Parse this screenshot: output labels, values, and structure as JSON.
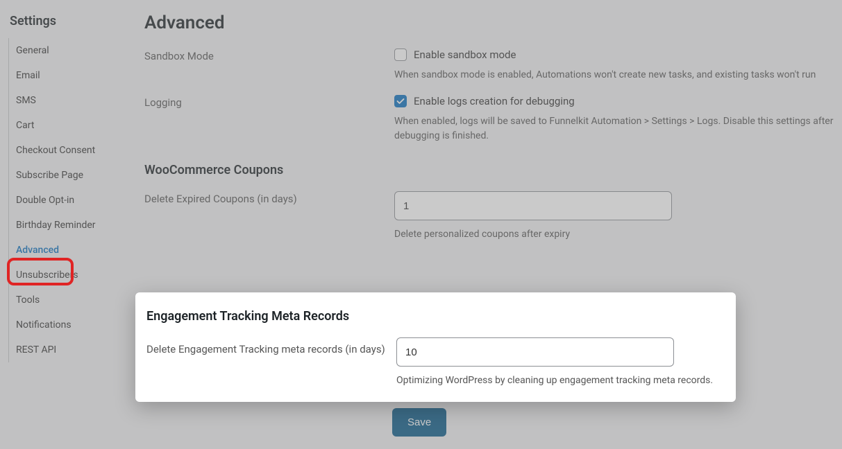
{
  "sidebar": {
    "title": "Settings",
    "items": [
      {
        "label": "General"
      },
      {
        "label": "Email"
      },
      {
        "label": "SMS"
      },
      {
        "label": "Cart"
      },
      {
        "label": "Checkout Consent"
      },
      {
        "label": "Subscribe Page"
      },
      {
        "label": "Double Opt-in"
      },
      {
        "label": "Birthday Reminder"
      },
      {
        "label": "Advanced",
        "active": true
      },
      {
        "label": "Unsubscribers"
      },
      {
        "label": "Tools"
      },
      {
        "label": "Notifications"
      },
      {
        "label": "REST API"
      }
    ]
  },
  "page": {
    "title": "Advanced"
  },
  "sandbox": {
    "label": "Sandbox Mode",
    "check_label": "Enable sandbox mode",
    "checked": false,
    "desc": "When sandbox mode is enabled, Automations won't create new tasks, and existing tasks won't run"
  },
  "logging": {
    "label": "Logging",
    "check_label": "Enable logs creation for debugging",
    "checked": true,
    "desc": "When enabled, logs will be saved to Funnelkit Automation > Settings > Logs. Disable this settings after debugging is finished."
  },
  "coupons": {
    "section": "WooCommerce Coupons",
    "label": "Delete Expired Coupons (in days)",
    "value": "1",
    "desc": "Delete personalized coupons after expiry"
  },
  "engagement": {
    "section": "Engagement Tracking Meta Records",
    "label": "Delete Engagement Tracking meta records (in days)",
    "value": "10",
    "desc": "Optimizing WordPress by cleaning up engagement tracking meta records."
  },
  "save_label": "Save"
}
